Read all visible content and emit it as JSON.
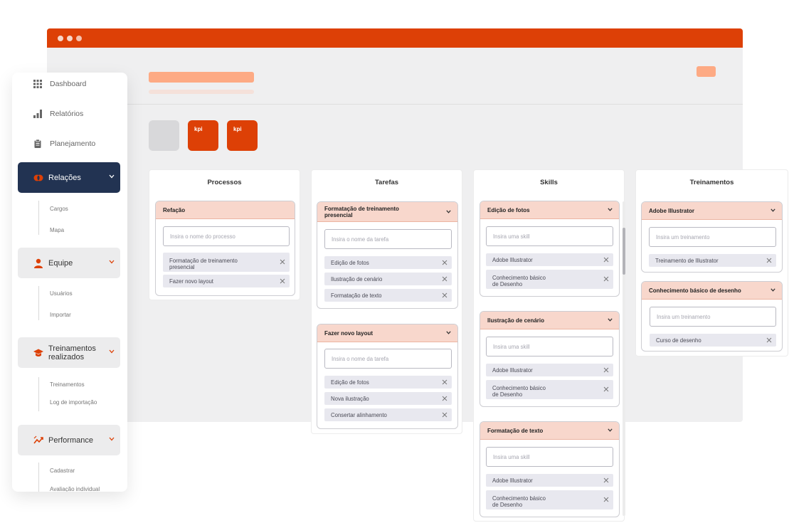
{
  "browser": {
    "kpis": [
      "",
      "kpi",
      "kpi"
    ]
  },
  "colors": {
    "brand": "#dd4006",
    "active_nav": "#223352",
    "card_header": "#f8d7cc",
    "placeholder": "#fdaa84"
  },
  "sidebar": {
    "top_items": [
      {
        "label": "Dashboard",
        "icon": "grid-icon"
      },
      {
        "label": "Relatórios",
        "icon": "bar-chart-icon"
      },
      {
        "label": "Planejamento",
        "icon": "clipboard-icon"
      }
    ],
    "groups": [
      {
        "label": "Relações",
        "icon": "handshake-icon",
        "active": true,
        "children": [
          "Cargos",
          "Mapa"
        ]
      },
      {
        "label": "Equipe",
        "icon": "user-icon",
        "active": false,
        "children": [
          "Usuários",
          "Importar"
        ]
      },
      {
        "label": "Treinamentos realizados",
        "label_lines": [
          "Treinamentos",
          "realizados"
        ],
        "icon": "graduation-cap-icon",
        "active": false,
        "children": [
          "Treinamentos",
          "Log de importação"
        ]
      },
      {
        "label": "Performance",
        "icon": "trend-icon",
        "active": false,
        "children": [
          "Cadastrar",
          "Avaliação individual"
        ]
      }
    ]
  },
  "columns": [
    {
      "title": "Processos",
      "cards": [
        {
          "title": "Refação",
          "placeholder": "Insira o nome do processo",
          "tags": [
            [
              "Formatação de treinamento",
              "presencial"
            ],
            [
              "Fazer novo layout"
            ]
          ]
        }
      ]
    },
    {
      "title": "Tarefas",
      "cards": [
        {
          "title_lines": [
            "Formatação de treinamento",
            "presencial"
          ],
          "placeholder": "Insira o nome da tarefa",
          "tags": [
            [
              "Edição de fotos"
            ],
            [
              "Ilustração de cenário"
            ],
            [
              "Formatação de texto"
            ]
          ]
        },
        {
          "title": "Fazer novo layout",
          "placeholder": "Insira o nome da tarefa",
          "tags": [
            [
              "Edição de fotos"
            ],
            [
              "Nova ilustração"
            ],
            [
              "Consertar alinhamento"
            ]
          ]
        }
      ]
    },
    {
      "title": "Skills",
      "cards": [
        {
          "title": "Edição de fotos",
          "placeholder": "Insira uma skill",
          "tags": [
            [
              "Adobe Illustrator"
            ],
            [
              "Conhecimento básico",
              "de Desenho"
            ]
          ]
        },
        {
          "title": "Ilustração de cenário",
          "placeholder": "Insira uma skill",
          "tags": [
            [
              "Adobe Illustrator"
            ],
            [
              "Conhecimento básico",
              "de Desenho"
            ]
          ]
        },
        {
          "title": "Formatação de texto",
          "placeholder": "Insira uma skill",
          "tags": [
            [
              "Adobe Illustrator"
            ],
            [
              "Conhecimento básico",
              "de Desenho"
            ]
          ]
        }
      ]
    },
    {
      "title": "Treinamentos",
      "cards": [
        {
          "title": "Adobe Illustrator",
          "placeholder": "Insira um treinamento",
          "tags": [
            [
              "Treinamento de Illustrator"
            ]
          ]
        },
        {
          "title": "Conhecimento básico de desenho",
          "placeholder": "Insira um treinamento",
          "tags": [
            [
              "Curso de desenho"
            ]
          ]
        }
      ]
    }
  ]
}
